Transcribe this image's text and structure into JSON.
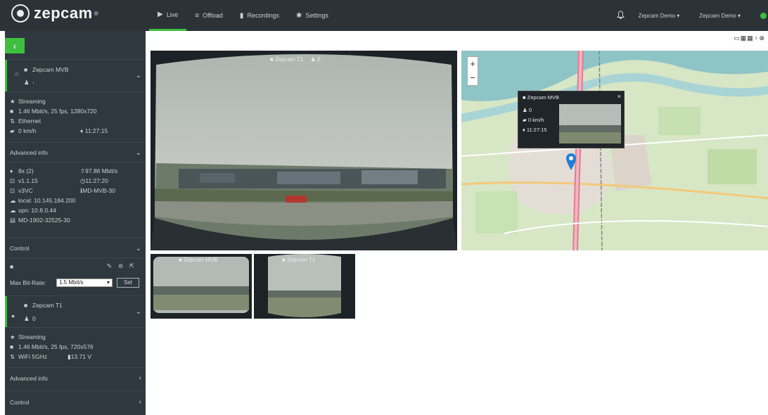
{
  "brand": {
    "name": "zepcam",
    "tm": "®"
  },
  "nav": {
    "items": [
      {
        "label": "Live",
        "icon": "video-icon",
        "glyph": "▶"
      },
      {
        "label": "Offload",
        "icon": "server-icon",
        "glyph": "≡"
      },
      {
        "label": "Recordings",
        "icon": "film-icon",
        "glyph": "▮"
      },
      {
        "label": "Settings",
        "icon": "gear-icon",
        "glyph": "✱"
      }
    ]
  },
  "header_right": {
    "org_menu": "Zepcam Demo ▾",
    "user_menu": "Zepcam Demo ▾"
  },
  "view_toolbar": {
    "glyphs": "▭▦▦♀⊕"
  },
  "sidebar": {
    "collapse_glyph": "‹",
    "device1": {
      "name": "Zepcam MVB",
      "user": "-",
      "status": "Streaming",
      "stream": "1.46 Mbit/s, 25 fps, 1280x720",
      "network": "Ethernet",
      "speed": "0 km/h",
      "time": "11:27:15",
      "advanced_title": "Advanced info",
      "advanced": {
        "sats": "8x (2)",
        "bitrate": "97.86 Mbit/s",
        "version": "v1.1.15",
        "uptime": "11:27:20",
        "codec": "v3VC",
        "device_id": "MD-MVB-30",
        "local_ip": "local: 10.145.184.200",
        "vpn_ip": "vpn: 10.8.0.44",
        "serial": "MD-1902-32525-30"
      },
      "control_title": "Control",
      "max_bitrate_label": "Max Bit-Rate:",
      "max_bitrate_value": "1.5 Mbit/s",
      "set_label": "Set"
    },
    "device2": {
      "name": "Zepcam T1",
      "user": "0",
      "status": "Streaming",
      "stream": "1.46 Mbit/s, 25 fps, 720x576",
      "network": "WiFi 5GHz",
      "battery": "13.71 V",
      "advanced_title": "Advanced info",
      "control_title": "Control"
    }
  },
  "main_video": {
    "label": "Zepcam T1",
    "count": "0"
  },
  "map_popup": {
    "title": "Zepcam MVB",
    "users": "0",
    "speed": "0 km/h",
    "time": "11:27:15",
    "close": "×"
  },
  "map_zoom": {
    "plus": "+",
    "minus": "−"
  },
  "thumbnails": [
    {
      "label": "Zepcam MVB"
    },
    {
      "label": "Zepcam T1"
    }
  ],
  "colors": {
    "accent": "#3fbf3f",
    "topbar": "#2b3338",
    "sidebar": "#2f383e",
    "marker": "#1f7fd6"
  }
}
